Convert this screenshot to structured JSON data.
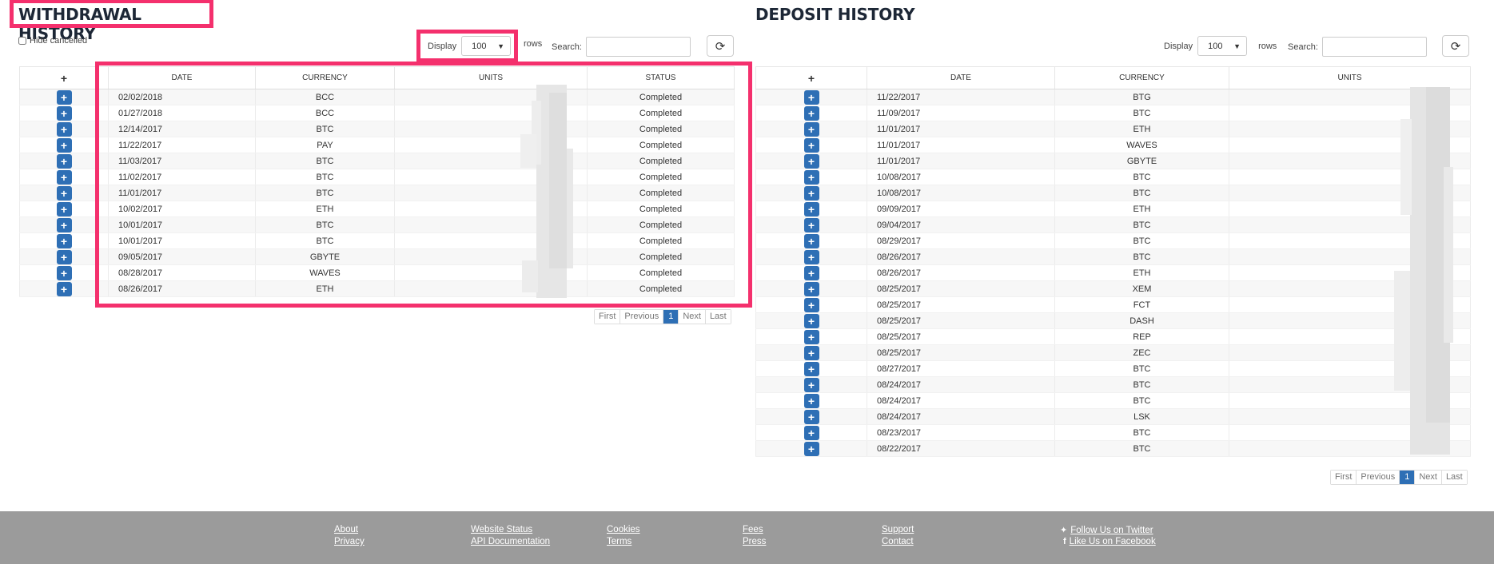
{
  "withdrawal": {
    "title": "WITHDRAWAL HISTORY",
    "hide_cancelled_label": "Hide cancelled",
    "display_label": "Display",
    "display_value": "100",
    "rows_label": "rows",
    "search_label": "Search:",
    "search_value": "",
    "columns": [
      "+",
      "DATE",
      "CURRENCY",
      "UNITS",
      "STATUS"
    ],
    "rows": [
      {
        "date": "02/02/2018",
        "currency": "BCC",
        "status": "Completed"
      },
      {
        "date": "01/27/2018",
        "currency": "BCC",
        "status": "Completed"
      },
      {
        "date": "12/14/2017",
        "currency": "BTC",
        "status": "Completed"
      },
      {
        "date": "11/22/2017",
        "currency": "PAY",
        "status": "Completed"
      },
      {
        "date": "11/03/2017",
        "currency": "BTC",
        "status": "Completed"
      },
      {
        "date": "11/02/2017",
        "currency": "BTC",
        "status": "Completed"
      },
      {
        "date": "11/01/2017",
        "currency": "BTC",
        "status": "Completed"
      },
      {
        "date": "10/02/2017",
        "currency": "ETH",
        "status": "Completed"
      },
      {
        "date": "10/01/2017",
        "currency": "BTC",
        "status": "Completed"
      },
      {
        "date": "10/01/2017",
        "currency": "BTC",
        "status": "Completed"
      },
      {
        "date": "09/05/2017",
        "currency": "GBYTE",
        "status": "Completed"
      },
      {
        "date": "08/28/2017",
        "currency": "WAVES",
        "status": "Completed"
      },
      {
        "date": "08/26/2017",
        "currency": "ETH",
        "status": "Completed"
      }
    ],
    "pager": {
      "first": "First",
      "previous": "Previous",
      "current": "1",
      "next": "Next",
      "last": "Last"
    }
  },
  "deposit": {
    "title": "DEPOSIT HISTORY",
    "display_label": "Display",
    "display_value": "100",
    "rows_label": "rows",
    "search_label": "Search:",
    "search_value": "",
    "columns": [
      "+",
      "DATE",
      "CURRENCY",
      "UNITS"
    ],
    "rows": [
      {
        "date": "11/22/2017",
        "currency": "BTG"
      },
      {
        "date": "11/09/2017",
        "currency": "BTC"
      },
      {
        "date": "11/01/2017",
        "currency": "ETH"
      },
      {
        "date": "11/01/2017",
        "currency": "WAVES"
      },
      {
        "date": "11/01/2017",
        "currency": "GBYTE"
      },
      {
        "date": "10/08/2017",
        "currency": "BTC"
      },
      {
        "date": "10/08/2017",
        "currency": "BTC"
      },
      {
        "date": "09/09/2017",
        "currency": "ETH"
      },
      {
        "date": "09/04/2017",
        "currency": "BTC"
      },
      {
        "date": "08/29/2017",
        "currency": "BTC"
      },
      {
        "date": "08/26/2017",
        "currency": "BTC"
      },
      {
        "date": "08/26/2017",
        "currency": "ETH"
      },
      {
        "date": "08/25/2017",
        "currency": "XEM"
      },
      {
        "date": "08/25/2017",
        "currency": "FCT"
      },
      {
        "date": "08/25/2017",
        "currency": "DASH"
      },
      {
        "date": "08/25/2017",
        "currency": "REP"
      },
      {
        "date": "08/25/2017",
        "currency": "ZEC"
      },
      {
        "date": "08/27/2017",
        "currency": "BTC"
      },
      {
        "date": "08/24/2017",
        "currency": "BTC"
      },
      {
        "date": "08/24/2017",
        "currency": "BTC"
      },
      {
        "date": "08/24/2017",
        "currency": "LSK"
      },
      {
        "date": "08/23/2017",
        "currency": "BTC"
      },
      {
        "date": "08/22/2017",
        "currency": "BTC"
      }
    ],
    "pager": {
      "first": "First",
      "previous": "Previous",
      "current": "1",
      "next": "Next",
      "last": "Last"
    }
  },
  "footer": {
    "about": "About",
    "privacy": "Privacy",
    "website_status": "Website Status",
    "api_documentation": "API Documentation",
    "cookies": "Cookies",
    "terms": "Terms",
    "fees": "Fees",
    "press": "Press",
    "support": "Support",
    "contact": "Contact",
    "twitter": "Follow Us on Twitter",
    "facebook": "Like Us on Facebook"
  },
  "icons": {
    "refresh": "refresh-icon",
    "expand": "plus-icon",
    "twitter": "twitter-icon",
    "facebook": "facebook-icon"
  },
  "colors": {
    "highlight": "#f4306d",
    "primary_button": "#2e6fb5",
    "footer_bg": "#9b9b9b",
    "title_text": "#1d2736"
  }
}
